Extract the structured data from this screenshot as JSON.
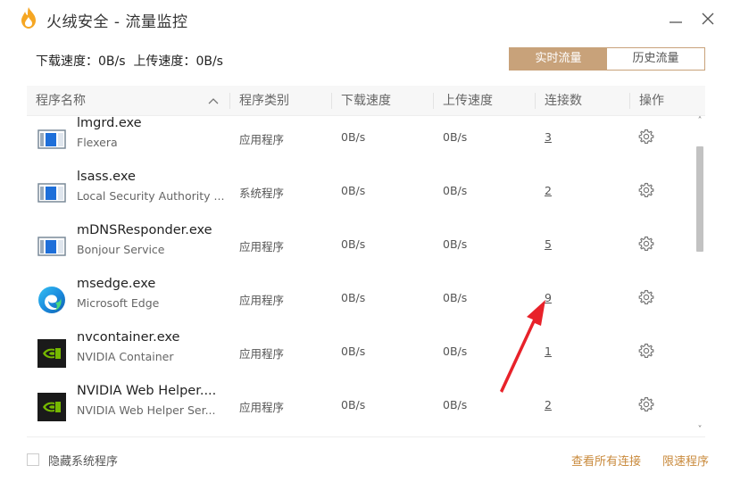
{
  "window": {
    "title": "火绒安全 - 流量监控",
    "brand_color": "#f5a623"
  },
  "speed": {
    "download_label": "下载速度：",
    "download_value": "0B/s",
    "upload_label": "上传速度：",
    "upload_value": "0B/s"
  },
  "tabs": [
    {
      "label": "实时流量",
      "active": true
    },
    {
      "label": "历史流量",
      "active": false
    }
  ],
  "columns": {
    "name": "程序名称",
    "type": "程序类别",
    "download": "下载速度",
    "upload": "上传速度",
    "connections": "连接数",
    "actions": "操作"
  },
  "rows": [
    {
      "name": "lmgrd.exe",
      "desc": "Flexera",
      "type": "应用程序",
      "download": "0B/s",
      "upload": "0B/s",
      "connections": "3",
      "icon": "window-icon"
    },
    {
      "name": "lsass.exe",
      "desc": "Local Security Authority ...",
      "type": "系统程序",
      "download": "0B/s",
      "upload": "0B/s",
      "connections": "2",
      "icon": "window-icon"
    },
    {
      "name": "mDNSResponder.exe",
      "desc": "Bonjour Service",
      "type": "应用程序",
      "download": "0B/s",
      "upload": "0B/s",
      "connections": "5",
      "icon": "window-icon"
    },
    {
      "name": "msedge.exe",
      "desc": "Microsoft Edge",
      "type": "应用程序",
      "download": "0B/s",
      "upload": "0B/s",
      "connections": "9",
      "icon": "edge-icon"
    },
    {
      "name": "nvcontainer.exe",
      "desc": "NVIDIA Container",
      "type": "应用程序",
      "download": "0B/s",
      "upload": "0B/s",
      "connections": "1",
      "icon": "nvidia-icon"
    },
    {
      "name": "NVIDIA Web Helper....",
      "desc": "NVIDIA Web Helper Ser...",
      "type": "应用程序",
      "download": "0B/s",
      "upload": "0B/s",
      "connections": "2",
      "icon": "nvidia-icon"
    }
  ],
  "footer": {
    "hide_system_label": "隐藏系统程序",
    "view_all_link": "查看所有连接",
    "limit_link": "限速程序"
  },
  "colors": {
    "accent": "#c8a27a",
    "link": "#c98a3c",
    "arrow": "#e8222a"
  }
}
